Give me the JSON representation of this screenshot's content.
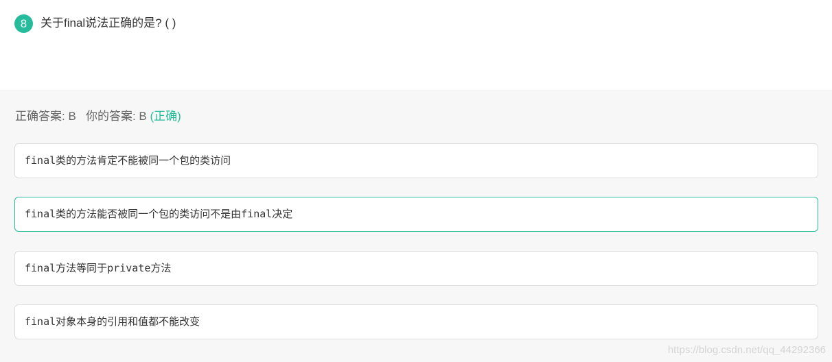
{
  "question": {
    "number": "8",
    "text": "关于final说法正确的是? ( )"
  },
  "answer": {
    "correct_label": "正确答案: B",
    "your_label": "你的答案: B",
    "result": "(正确)"
  },
  "options": [
    {
      "text": "final类的方法肯定不能被同一个包的类访问"
    },
    {
      "text": "final类的方法能否被同一个包的类访问不是由final决定"
    },
    {
      "text": "final方法等同于private方法"
    },
    {
      "text": "final对象本身的引用和值都不能改变"
    }
  ],
  "watermark": "https://blog.csdn.net/qq_44292366",
  "colors": {
    "accent": "#25bb9b",
    "border": "#dddddd",
    "background": "#f7f7f7"
  }
}
